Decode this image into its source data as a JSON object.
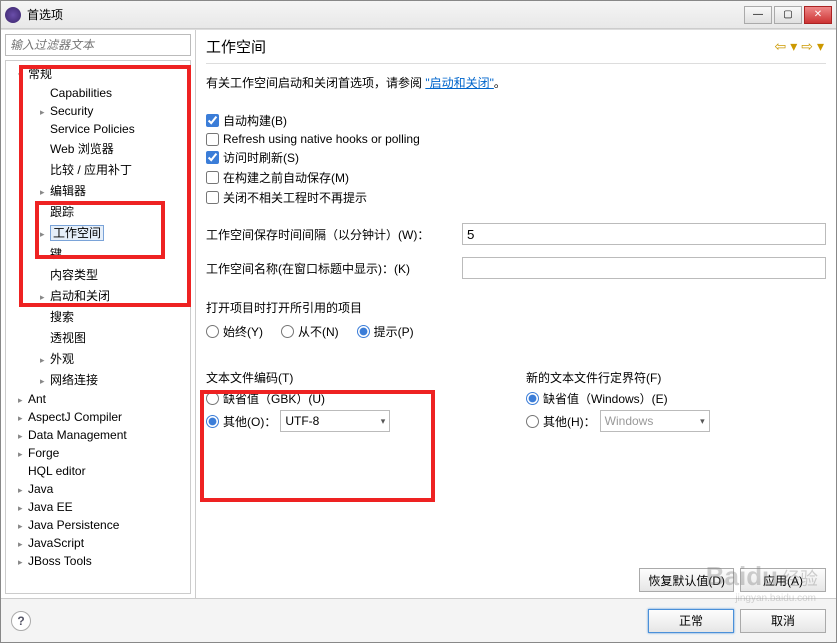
{
  "window": {
    "title": "首选项"
  },
  "sidebar": {
    "filter_placeholder": "输入过滤器文本",
    "items": [
      {
        "lvl": 1,
        "exp": "▾",
        "label": "常规"
      },
      {
        "lvl": 2,
        "exp": "",
        "label": "Capabilities"
      },
      {
        "lvl": 2,
        "exp": "▸",
        "label": "Security"
      },
      {
        "lvl": 2,
        "exp": "",
        "label": "Service Policies"
      },
      {
        "lvl": 2,
        "exp": "",
        "label": "Web 浏览器"
      },
      {
        "lvl": 2,
        "exp": "",
        "label": "比较 / 应用补丁"
      },
      {
        "lvl": 2,
        "exp": "▸",
        "label": "编辑器"
      },
      {
        "lvl": 2,
        "exp": "",
        "label": "跟踪"
      },
      {
        "lvl": 2,
        "exp": "▸",
        "label": "工作空间",
        "sel": true
      },
      {
        "lvl": 2,
        "exp": "",
        "label": "键"
      },
      {
        "lvl": 2,
        "exp": "",
        "label": "内容类型"
      },
      {
        "lvl": 2,
        "exp": "▸",
        "label": "启动和关闭"
      },
      {
        "lvl": 2,
        "exp": "",
        "label": "搜索"
      },
      {
        "lvl": 2,
        "exp": "",
        "label": "透视图"
      },
      {
        "lvl": 2,
        "exp": "▸",
        "label": "外观"
      },
      {
        "lvl": 2,
        "exp": "▸",
        "label": "网络连接"
      },
      {
        "lvl": 1,
        "exp": "▸",
        "label": "Ant"
      },
      {
        "lvl": 1,
        "exp": "▸",
        "label": "AspectJ Compiler"
      },
      {
        "lvl": 1,
        "exp": "▸",
        "label": "Data Management"
      },
      {
        "lvl": 1,
        "exp": "▸",
        "label": "Forge"
      },
      {
        "lvl": 1,
        "exp": "",
        "label": "HQL editor"
      },
      {
        "lvl": 1,
        "exp": "▸",
        "label": "Java"
      },
      {
        "lvl": 1,
        "exp": "▸",
        "label": "Java EE"
      },
      {
        "lvl": 1,
        "exp": "▸",
        "label": "Java Persistence"
      },
      {
        "lvl": 1,
        "exp": "▸",
        "label": "JavaScript"
      },
      {
        "lvl": 1,
        "exp": "▸",
        "label": "JBoss Tools"
      }
    ]
  },
  "main": {
    "title": "工作空间",
    "desc_prefix": "有关工作空间启动和关闭首选项，请参阅  ",
    "desc_link": "\"启动和关闭\"",
    "desc_suffix": "。",
    "checks": [
      {
        "checked": true,
        "label": "自动构建(B)"
      },
      {
        "checked": false,
        "label": "Refresh using native hooks or polling"
      },
      {
        "checked": true,
        "label": "访问时刷新(S)"
      },
      {
        "checked": false,
        "label": "在构建之前自动保存(M)"
      },
      {
        "checked": false,
        "label": "关闭不相关工程时不再提示"
      }
    ],
    "save_interval_label": "工作空间保存时间间隔（以分钟计）(W)：",
    "save_interval_value": "5",
    "ws_name_label": "工作空间名称(在窗口标题中显示)：(K)",
    "ws_name_value": "",
    "open_ref_title": "打开项目时打开所引用的项目",
    "open_ref_opts": [
      "始终(Y)",
      "从不(N)",
      "提示(P)"
    ],
    "encoding": {
      "title": "文本文件编码(T)",
      "default_label": "缺省值（GBK）(U)",
      "other_label": "其他(O)：",
      "other_value": "UTF-8"
    },
    "delim": {
      "title": "新的文本文件行定界符(F)",
      "default_label": "缺省值（Windows）(E)",
      "other_label": "其他(H)：",
      "other_value": "Windows"
    },
    "restore_btn": "恢复默认值(D)",
    "apply_btn": "应用(A)"
  },
  "footer": {
    "ok": "正常",
    "cancel": "取消"
  },
  "watermark": {
    "brand": "Baidu",
    "jy": "经验",
    "url": "jingyan.baidu.com"
  }
}
